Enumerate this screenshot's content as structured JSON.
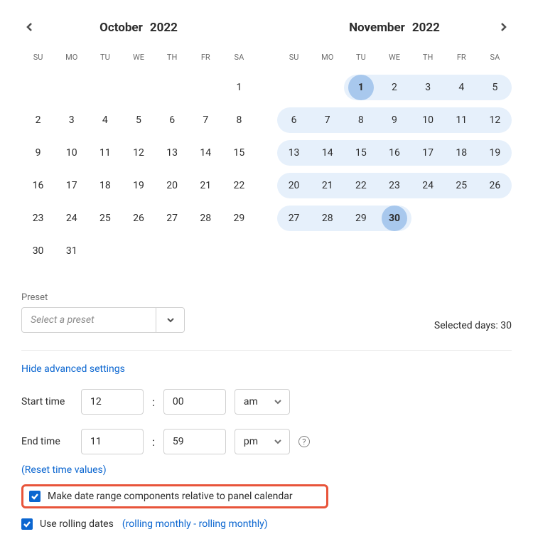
{
  "left": {
    "month": "October",
    "year": "2022",
    "days": [
      [
        null,
        null,
        null,
        null,
        null,
        null,
        1
      ],
      [
        2,
        3,
        4,
        5,
        6,
        7,
        8
      ],
      [
        9,
        10,
        11,
        12,
        13,
        14,
        15
      ],
      [
        16,
        17,
        18,
        19,
        20,
        21,
        22
      ],
      [
        23,
        24,
        25,
        26,
        27,
        28,
        29
      ],
      [
        30,
        31,
        null,
        null,
        null,
        null,
        null
      ]
    ],
    "range": []
  },
  "right": {
    "month": "November",
    "year": "2022",
    "days": [
      [
        null,
        null,
        1,
        2,
        3,
        4,
        5
      ],
      [
        6,
        7,
        8,
        9,
        10,
        11,
        12
      ],
      [
        13,
        14,
        15,
        16,
        17,
        18,
        19
      ],
      [
        20,
        21,
        22,
        23,
        24,
        25,
        26
      ],
      [
        27,
        28,
        29,
        30,
        null,
        null,
        null
      ]
    ],
    "range_start": 1,
    "range_end": 30
  },
  "weekdays": [
    "SU",
    "MO",
    "TU",
    "WE",
    "TH",
    "FR",
    "SA"
  ],
  "preset": {
    "label": "Preset",
    "placeholder": "Select a preset"
  },
  "selected_days_label": "Selected days: 30",
  "advanced_toggle": "Hide advanced settings",
  "start_time": {
    "label": "Start time",
    "hour": "12",
    "minute": "00",
    "ampm": "am"
  },
  "end_time": {
    "label": "End time",
    "hour": "11",
    "minute": "59",
    "ampm": "pm"
  },
  "reset_link": "(Reset time values)",
  "relative_checkbox_label": "Make date range components relative to panel calendar",
  "rolling_checkbox_label": "Use rolling dates",
  "rolling_detail": "(rolling monthly - rolling monthly)"
}
